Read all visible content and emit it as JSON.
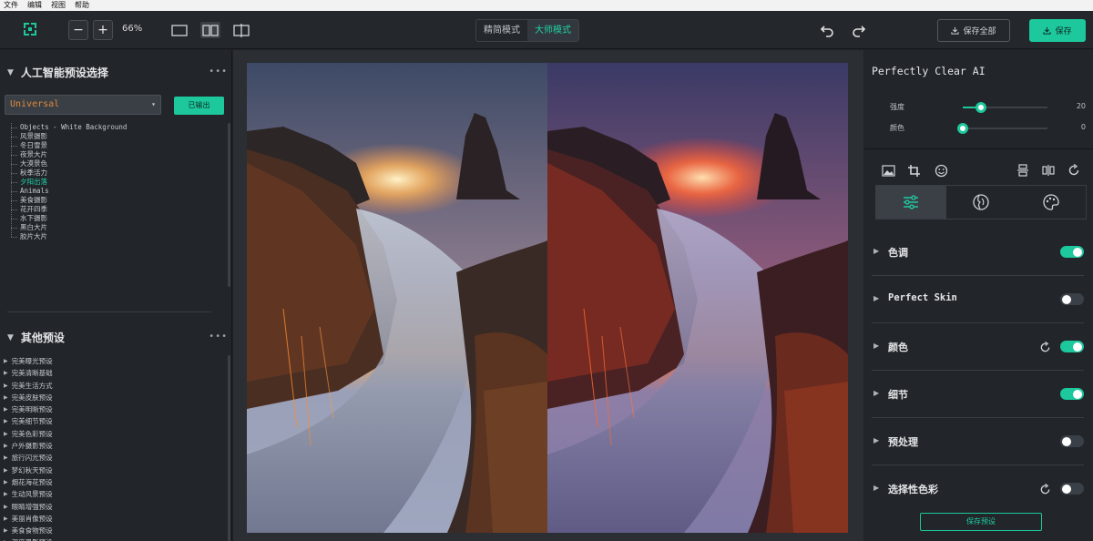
{
  "menu": [
    "文件",
    "编辑",
    "视图",
    "帮助"
  ],
  "toolbar": {
    "zoom_out": "−",
    "zoom_in": "+",
    "zoom_level": "66%",
    "modes": [
      "精简模式",
      "大师模式"
    ],
    "active_mode": "大师模式",
    "save_all": "保存全部",
    "save": "保存",
    "accent": "#1cc89c"
  },
  "left": {
    "ai_title": "人工智能预设选择",
    "selected_preset": "Universal",
    "export_button": "已输出",
    "tree": [
      {
        "label": "Objects - White Background",
        "cat": true
      },
      {
        "label": "风景摄影"
      },
      {
        "label": "冬日雪景"
      },
      {
        "label": "夜景大片"
      },
      {
        "label": "大漠景色"
      },
      {
        "label": "秋季活力"
      },
      {
        "label": "夕阳出落",
        "selected": true
      },
      {
        "label": "Animals",
        "cat": true
      },
      {
        "label": "美食摄影"
      },
      {
        "label": "花开四季"
      },
      {
        "label": "水下摄影"
      },
      {
        "label": "黑白大片"
      },
      {
        "label": "胶片大片"
      }
    ],
    "other_title": "其他预设",
    "other_presets": [
      "完美曝光预设",
      "完美清晰基础",
      "完美生活方式",
      "完美皮肤预设",
      "完美明晰预设",
      "完美细节预设",
      "完美色彩预设",
      "户外摄影预设",
      "旅行闪光预设",
      "梦幻秋天预设",
      "烟花海花预设",
      "生动风景预设",
      "眼睛增强预设",
      "美丽肖像预设",
      "美食食物预设",
      "深度黑影预设"
    ]
  },
  "right": {
    "title": "Perfectly Clear AI",
    "sliders": [
      {
        "label": "强度",
        "value": 20,
        "fraction": 0.2
      },
      {
        "label": "颜色",
        "value": 0,
        "fraction": 0.0
      }
    ],
    "sections": [
      {
        "label": "色调",
        "on": true,
        "reset": false,
        "mono": false
      },
      {
        "label": "Perfect Skin",
        "on": false,
        "reset": false,
        "mono": true
      },
      {
        "label": "颜色",
        "on": true,
        "reset": true,
        "mono": false
      },
      {
        "label": "细节",
        "on": true,
        "reset": false,
        "mono": false
      },
      {
        "label": "预处理",
        "on": false,
        "reset": false,
        "mono": false
      },
      {
        "label": "选择性色彩",
        "on": false,
        "reset": true,
        "mono": false
      }
    ],
    "save_preset": "保存预设"
  }
}
